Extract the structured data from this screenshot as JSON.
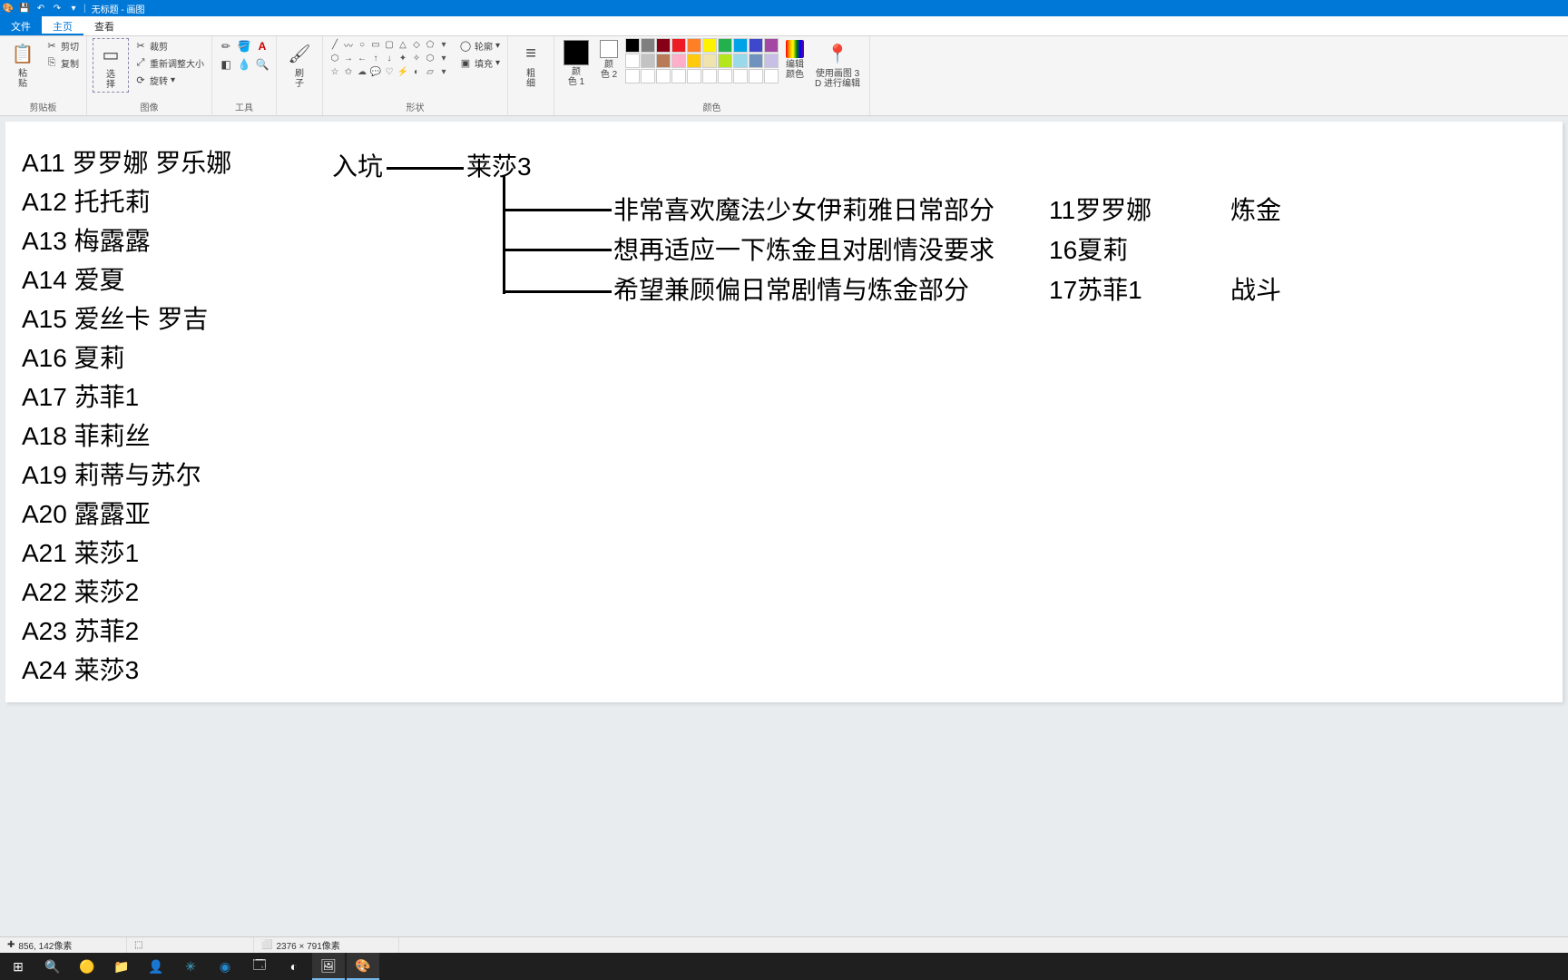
{
  "window": {
    "title_doc": "无标题",
    "title_app": "画图"
  },
  "tabs": {
    "file": "文件",
    "home": "主页",
    "view": "查看"
  },
  "ribbon": {
    "clipboard": {
      "label": "剪贴板",
      "paste": "粘\n贴",
      "cut": "剪切",
      "copy": "复制"
    },
    "image": {
      "label": "图像",
      "select": "选\n择",
      "crop": "裁剪",
      "resize": "重新调整大小",
      "rotate": "旋转"
    },
    "tools": {
      "label": "工具"
    },
    "brushes": {
      "label": "",
      "brush": "刷\n子"
    },
    "shapes": {
      "label": "形状",
      "outline": "轮廓",
      "fill": "填充"
    },
    "size": {
      "label": "",
      "btn": "粗\n细"
    },
    "colors": {
      "label": "颜色",
      "c1": "颜\n色 1",
      "c2": "颜\n色 2",
      "edit": "编辑\n颜色"
    },
    "paint3d": {
      "label": "",
      "btn": "使用画图 3\nD 进行编辑"
    }
  },
  "canvas_text": {
    "list": [
      "A11 罗罗娜 罗乐娜",
      "A12 托托莉",
      "A13 梅露露",
      "A14 爱夏",
      "A15 爱丝卡 罗吉",
      "A16 夏莉",
      "A17 苏菲1",
      "A18 菲莉丝",
      "A19 莉蒂与苏尔",
      "A20 露露亚",
      "A21 莱莎1",
      "A22 莱莎2",
      "A23 苏菲2",
      "A24 莱莎3"
    ],
    "node_start": "入坑",
    "node_ryza": "莱莎3",
    "branch1": "非常喜欢魔法少女伊莉雅日常部分",
    "branch2": "想再适应一下炼金且对剧情没要求",
    "branch3": "希望兼顾偏日常剧情与炼金部分",
    "right1": "11罗罗娜",
    "right2": "16夏莉",
    "right3": "17苏菲1",
    "far1": "炼金",
    "far2": "战斗"
  },
  "colors_row1": [
    "#000000",
    "#7f7f7f",
    "#880015",
    "#ed1c24",
    "#ff7f27",
    "#fff200",
    "#22b14c",
    "#00a2e8",
    "#3f48cc",
    "#a349a4"
  ],
  "colors_row2": [
    "#ffffff",
    "#c3c3c3",
    "#b97a57",
    "#ffaec9",
    "#ffc90e",
    "#efe4b0",
    "#b5e61d",
    "#99d9ea",
    "#7092be",
    "#c8bfe7"
  ],
  "status": {
    "coords_icon": "✚",
    "coords": "856, 142像素",
    "sel_icon": "⬚",
    "size_icon": "⬜",
    "size": "2376 × 791像素"
  }
}
